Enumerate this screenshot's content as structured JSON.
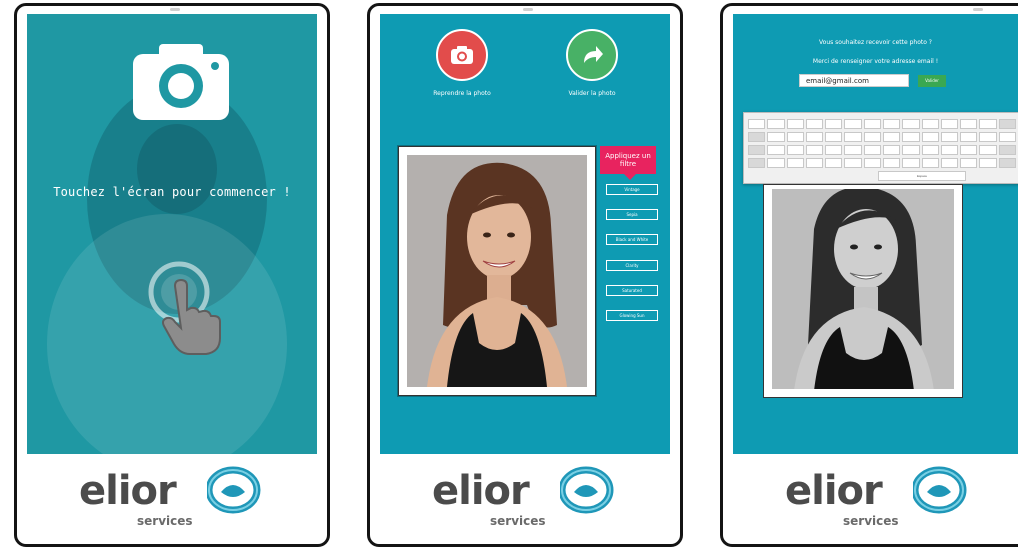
{
  "screen1": {
    "start_text": "Touchez l'écran pour commencer !"
  },
  "screen2": {
    "retake_label": "Reprendre la photo",
    "validate_label": "Valider la photo",
    "filter_title": "Appliquez un filtre",
    "filters": [
      "Vintage",
      "Sepia",
      "Black and White",
      "Clarity",
      "Saturated",
      "Glowing Sun"
    ]
  },
  "screen3": {
    "question": "Vous souhaitez recevoir cette photo ?",
    "instruction": "Merci de renseigner votre adresse email !",
    "email_value": "email@gmail.com",
    "send_label": "Valider",
    "space_label": "Espace"
  },
  "brand": {
    "word": "elior",
    "sub": "services",
    "swirl_color": "#1f97b8",
    "text_color": "#4b4b4b"
  },
  "icons": [
    "camera-icon",
    "touch-hand-icon",
    "camera-icon",
    "forward-arrow-icon",
    "elior-swirl-logo"
  ],
  "colors": {
    "screen1_bg": "#1f98a3",
    "screen_bg": "#0e9bb3",
    "retake": "#e24c4b",
    "validate": "#48b166",
    "filter_tag": "#e8235f",
    "send": "#3aa852"
  }
}
